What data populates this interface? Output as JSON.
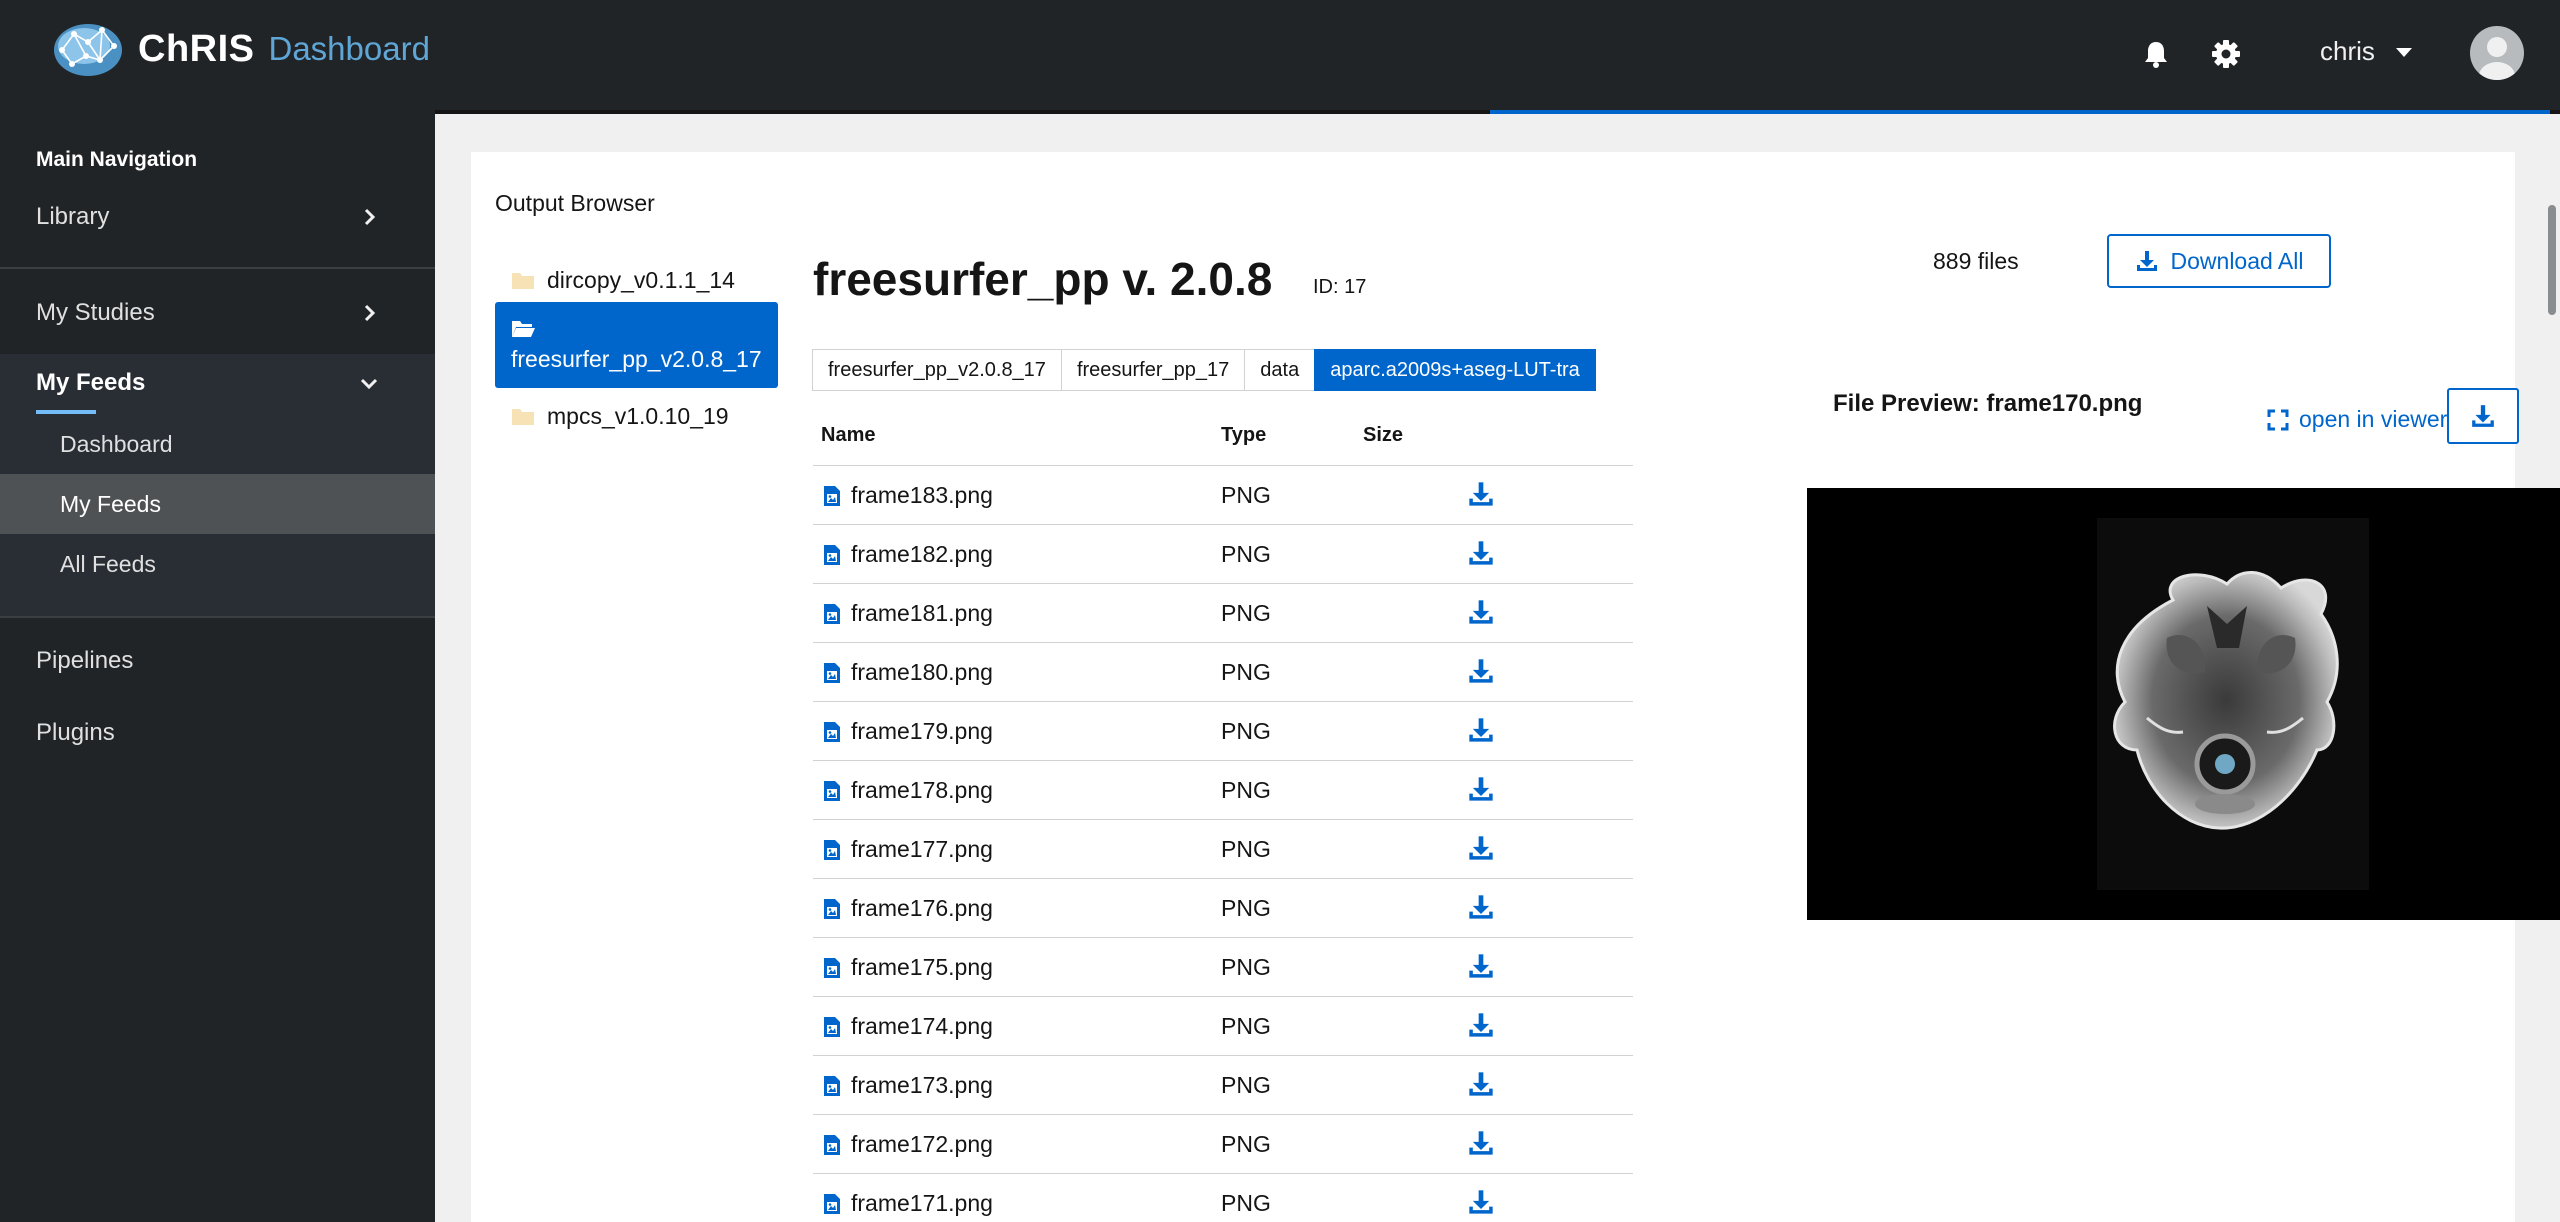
{
  "header": {
    "brand_name": "ChRIS",
    "brand_sub": "Dashboard",
    "username": "chris",
    "icons": [
      "bell-icon",
      "gear-icon",
      "caret-down-icon",
      "avatar"
    ]
  },
  "sidebar": {
    "section_title": "Main Navigation",
    "items": [
      {
        "label": "Library"
      },
      {
        "label": "My Studies"
      },
      {
        "label": "My Feeds"
      },
      {
        "label": "Pipelines"
      },
      {
        "label": "Plugins"
      }
    ],
    "sub_items": [
      {
        "label": "Dashboard"
      },
      {
        "label": "My Feeds"
      },
      {
        "label": "All Feeds"
      }
    ]
  },
  "browser": {
    "title": "Output Browser",
    "dirs": [
      {
        "label": "dircopy_v0.1.1_14"
      },
      {
        "label": "freesurfer_pp_v2.0.8_17"
      },
      {
        "label": "mpcs_v1.0.10_19"
      }
    ],
    "plugin_title": "freesurfer_pp v. 2.0.8",
    "plugin_id": "ID: 17",
    "files_count": "889 files",
    "download_all": "Download All",
    "breadcrumbs": [
      "freesurfer_pp_v2.0.8_17",
      "freesurfer_pp_17",
      "data",
      "aparc.a2009s+aseg-LUT-tra"
    ],
    "columns": {
      "name": "Name",
      "type": "Type",
      "size": "Size"
    },
    "files": [
      {
        "name": "frame183.png",
        "type": "PNG"
      },
      {
        "name": "frame182.png",
        "type": "PNG"
      },
      {
        "name": "frame181.png",
        "type": "PNG"
      },
      {
        "name": "frame180.png",
        "type": "PNG"
      },
      {
        "name": "frame179.png",
        "type": "PNG"
      },
      {
        "name": "frame178.png",
        "type": "PNG"
      },
      {
        "name": "frame177.png",
        "type": "PNG"
      },
      {
        "name": "frame176.png",
        "type": "PNG"
      },
      {
        "name": "frame175.png",
        "type": "PNG"
      },
      {
        "name": "frame174.png",
        "type": "PNG"
      },
      {
        "name": "frame173.png",
        "type": "PNG"
      },
      {
        "name": "frame172.png",
        "type": "PNG"
      },
      {
        "name": "frame171.png",
        "type": "PNG"
      }
    ],
    "preview_title": "File Preview: frame170.png",
    "open_in_viewer": "open in viewer"
  },
  "colors": {
    "header_bg": "#212427",
    "accent": "#0066cc",
    "brand_sub": "#5fa6d6"
  }
}
